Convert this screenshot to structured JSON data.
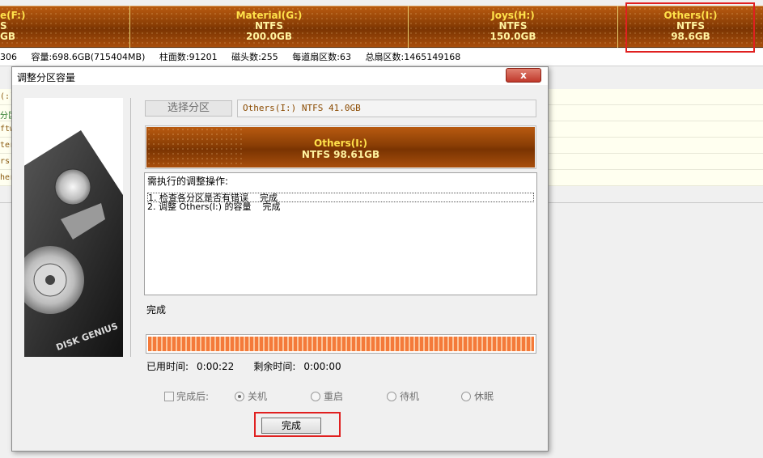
{
  "partitions": [
    {
      "name": "e(F:)",
      "fs": "S",
      "size": "GB"
    },
    {
      "name": "Material(G:)",
      "fs": "NTFS",
      "size": "200.0GB"
    },
    {
      "name": "Joys(H:)",
      "fs": "NTFS",
      "size": "150.0GB"
    },
    {
      "name": "Others(I:)",
      "fs": "NTFS",
      "size": "98.6GB"
    }
  ],
  "infobar": {
    "a": "306",
    "capacity": "容量:698.6GB(715404MB)",
    "cylinders": "柱面数:91201",
    "heads": "磁头数:255",
    "sectors_per_track": "每道扇区数:63",
    "total_sectors": "总扇区数:1465149168"
  },
  "bg_list": [
    "(:)",
    "分区",
    "ftw",
    "ter",
    "rs",
    "her"
  ],
  "dialog": {
    "title": "调整分区容量",
    "close_label": "x",
    "select_partition_label": "选择分区",
    "selected_info": "Others(I:) NTFS 41.0GB",
    "partition_name": "Others(I:)",
    "partition_size": "NTFS 98.61GB",
    "ops_header": "需执行的调整操作:",
    "ops": [
      "1. 检查各分区是否有错误    完成",
      "2. 调整 Others(I:) 的容量    完成"
    ],
    "status": "完成",
    "progress": 1.0,
    "elapsed_label": "已用时间:",
    "elapsed": "0:00:22",
    "remaining_label": "剩余时间:",
    "remaining": "0:00:00",
    "after_done_label": "完成后:",
    "options": [
      "关机",
      "重启",
      "待机",
      "休眠"
    ],
    "selected_option": "关机",
    "ok_label": "完成",
    "logo_text": "DISK GENIUS"
  },
  "colors": {
    "partition": "#8a3e05",
    "partition_label": "#ffe14a",
    "highlight": "#e02020",
    "progress": "#f47a3a"
  }
}
